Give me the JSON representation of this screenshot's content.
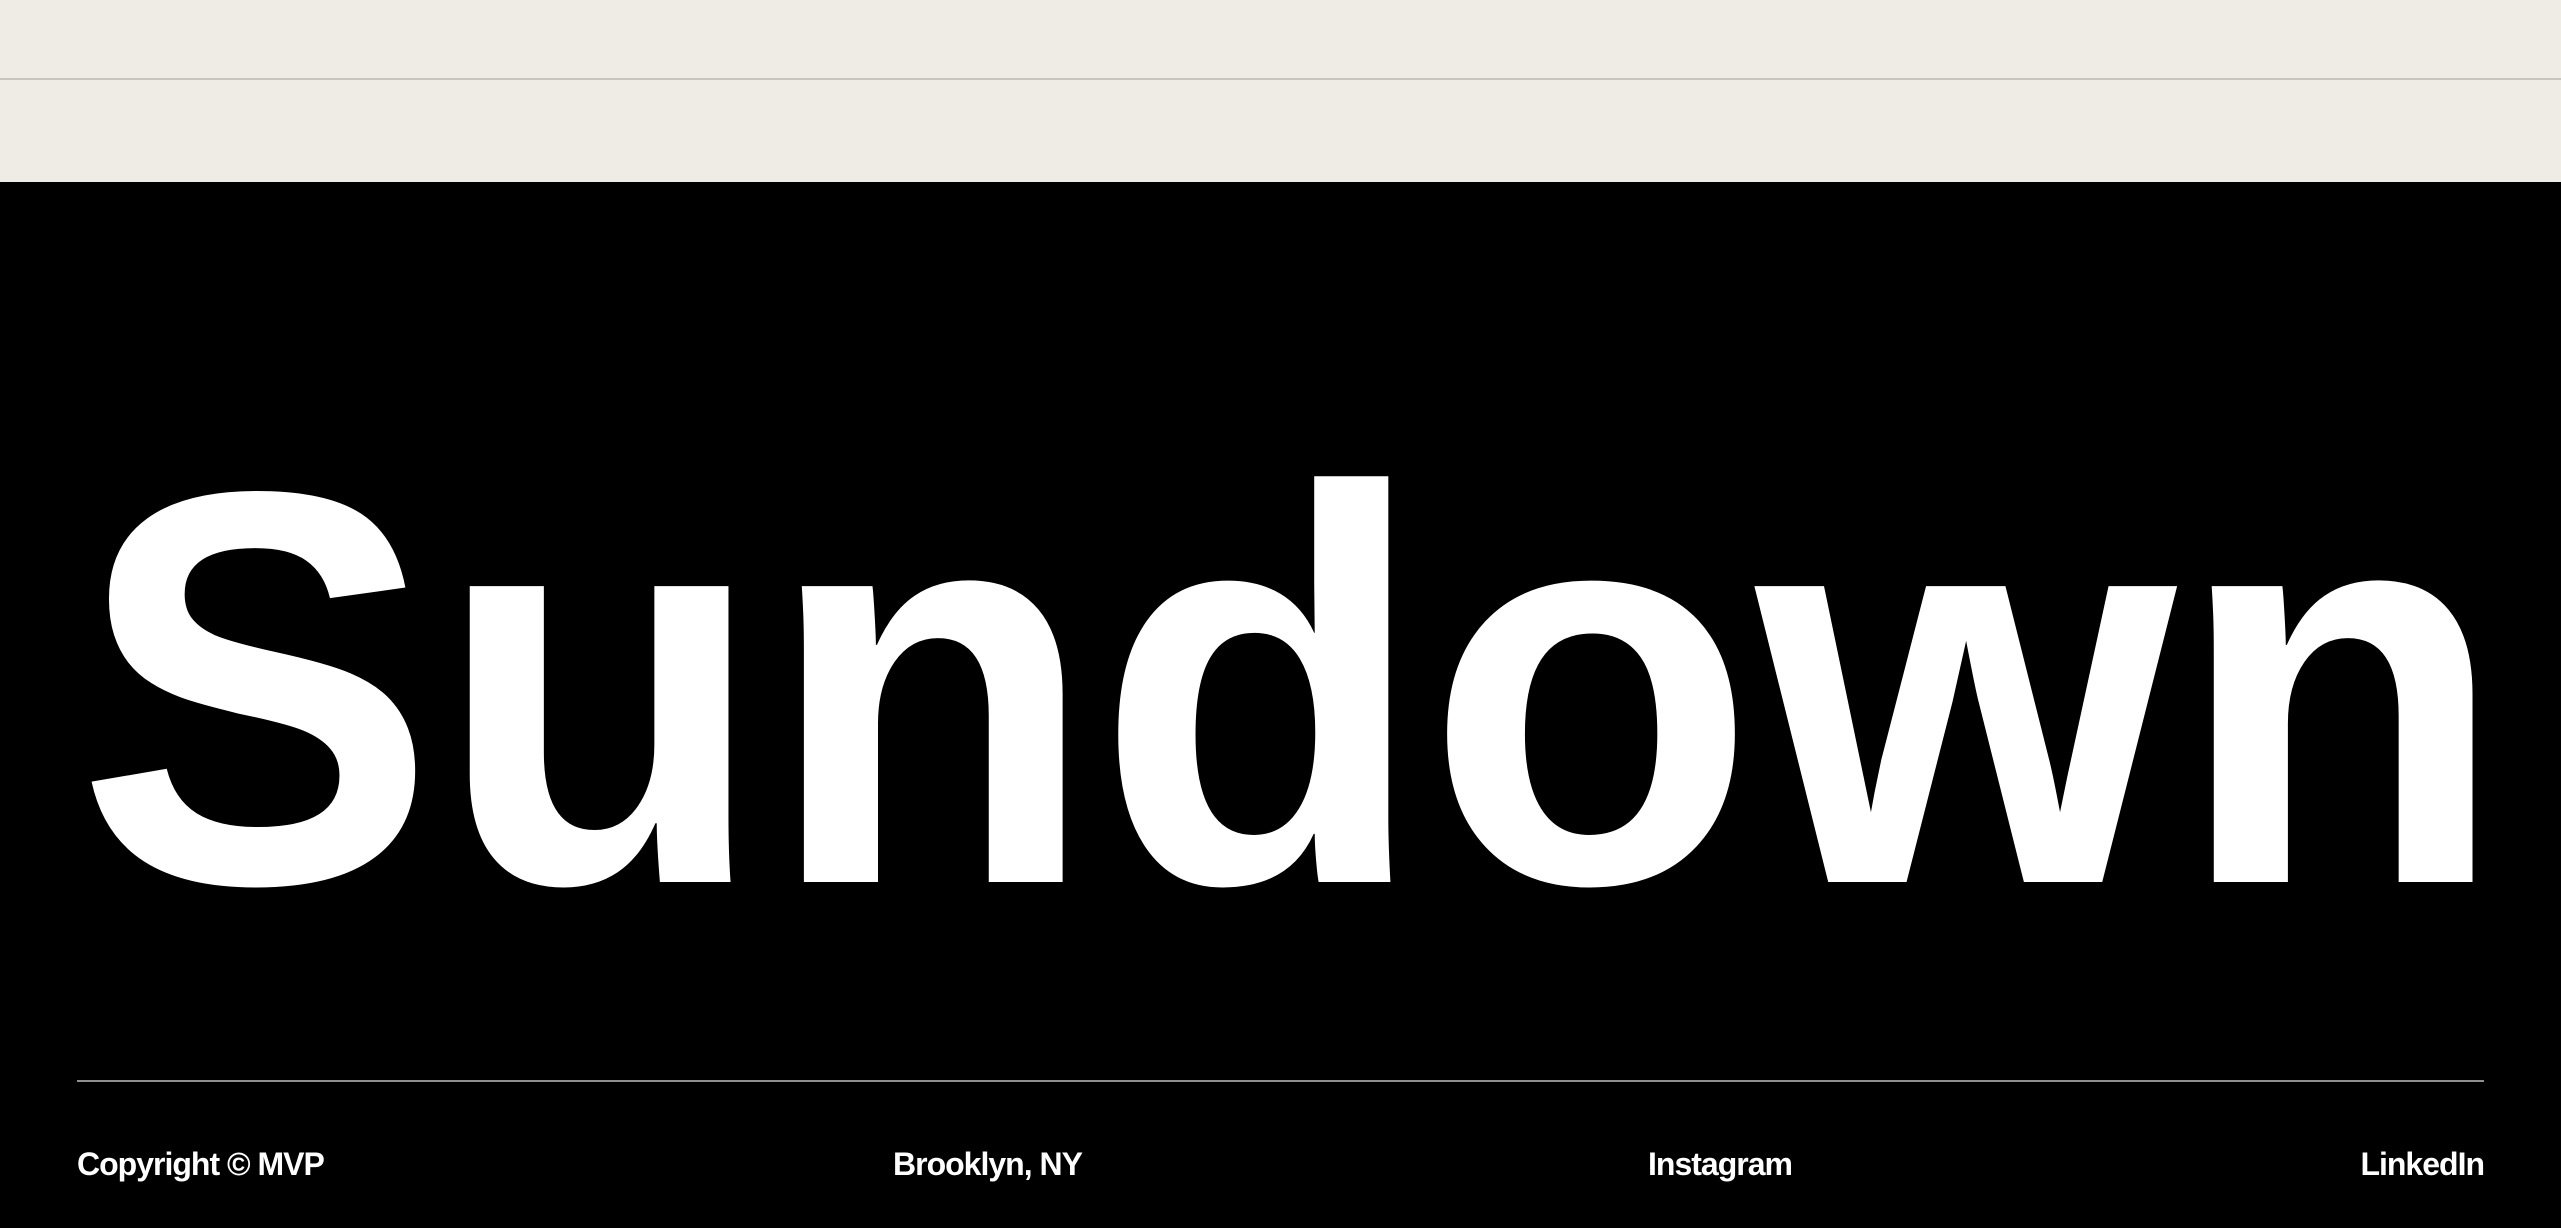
{
  "footer": {
    "wordmark": "Sundown",
    "copyright": "Copyright © MVP",
    "location": "Brooklyn, NY",
    "instagram_label": "Instagram",
    "linkedin_label": "LinkedIn"
  },
  "colors": {
    "top_background": "#efebe5",
    "footer_background": "#000000",
    "footer_text": "#ffffff"
  }
}
